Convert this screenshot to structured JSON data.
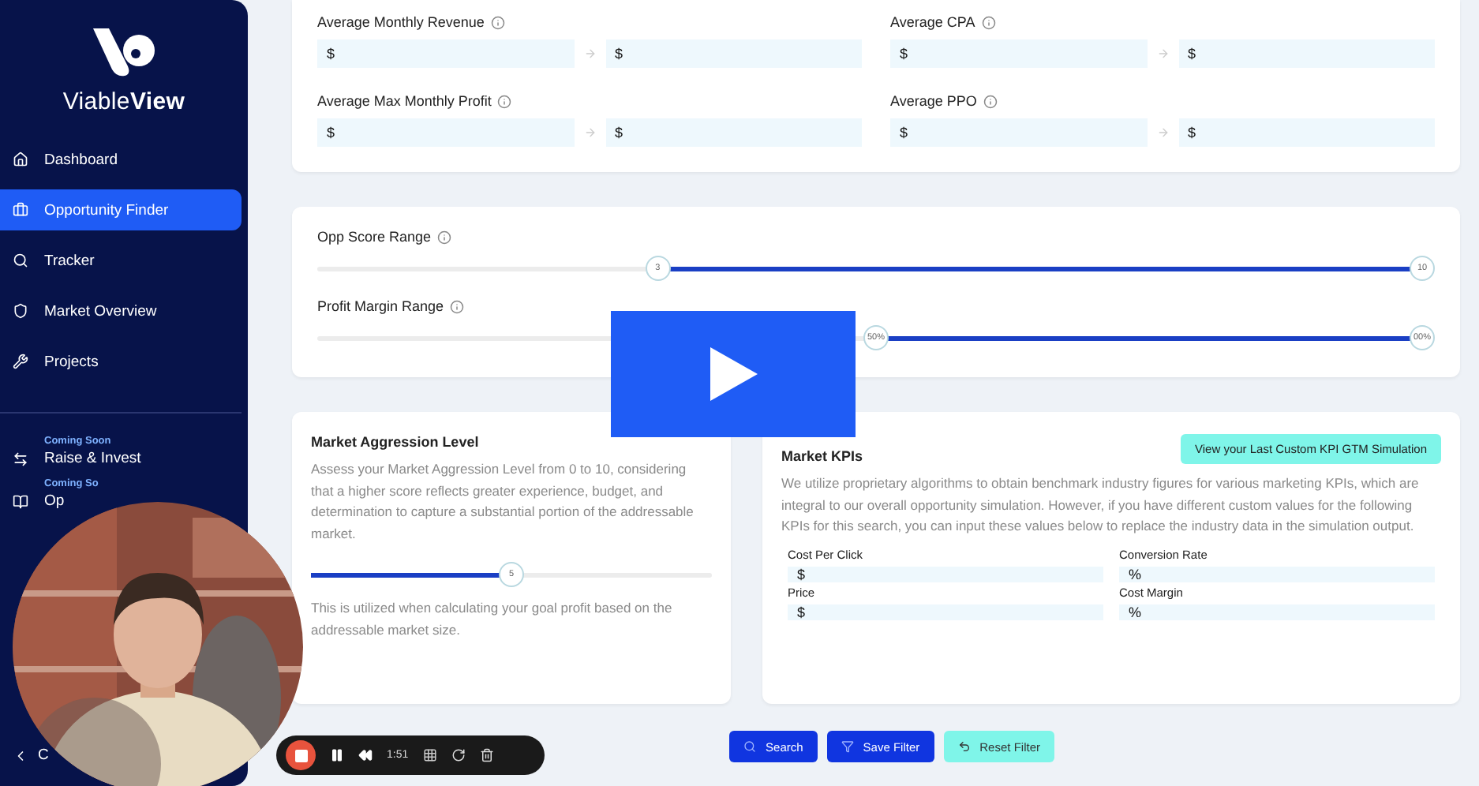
{
  "sidebar": {
    "logo_light": "Viable",
    "logo_bold": "View",
    "items": [
      {
        "label": "Dashboard",
        "selected": false
      },
      {
        "label": "Opportunity Finder",
        "selected": true
      },
      {
        "label": "Tracker",
        "selected": false
      },
      {
        "label": "Market Overview",
        "selected": false
      },
      {
        "label": "Projects",
        "selected": false
      }
    ],
    "soon_items": [
      {
        "badge": "Coming Soon",
        "label": "Raise & Invest"
      },
      {
        "badge": "Coming So",
        "label": "Op"
      }
    ],
    "collapse": {
      "label": "C"
    }
  },
  "filters": [
    {
      "label": "Average Monthly Revenue",
      "prefix": "$"
    },
    {
      "label": "Average CPA",
      "prefix": "$"
    },
    {
      "label": "Average Max Monthly Profit",
      "prefix": "$"
    },
    {
      "label": "Average PPO",
      "prefix": "$"
    }
  ],
  "range_sliders": [
    {
      "label": "Opp Score Range",
      "thumbs": [
        {
          "label": "3",
          "level": 0.3
        },
        {
          "label": "10",
          "level": 1
        }
      ]
    },
    {
      "label": "Profit Margin Range",
      "thumbs": [
        {
          "label": "50%",
          "level": 0.5
        },
        {
          "label": "00%",
          "level": 1
        }
      ]
    }
  ],
  "aggression": {
    "title": "Market Aggression Level",
    "description": "Assess your Market Aggression Level from 0 to 10, considering that a higher score reflects greater experience, budget, and determination to capture a substantial portion of the addressable market.",
    "slider": {
      "label": "5",
      "level": 0.5
    },
    "note": "This is utilized when calculating your goal profit based on the addressable market size."
  },
  "kpis": {
    "title": "Market KPIs",
    "button": "View your Last Custom KPI GTM Simulation",
    "description": "We utilize proprietary algorithms to obtain benchmark industry figures for various marketing KPIs, which are integral to our overall opportunity simulation. However, if you have different custom values for the following KPIs for this search, you can input these values below to replace the industry data in the simulation output.",
    "fields": [
      {
        "label": "Cost Per Click",
        "prefix": "$"
      },
      {
        "label": "Conversion Rate",
        "prefix": "%"
      },
      {
        "label": "Price",
        "prefix": "$"
      },
      {
        "label": "Cost Margin",
        "prefix": "%"
      }
    ]
  },
  "actions": [
    {
      "label": "Search",
      "kind": "primary"
    },
    {
      "label": "Save Filter",
      "kind": "primary"
    },
    {
      "label": "Reset Filter",
      "kind": "secondary"
    }
  ],
  "recorder": {
    "time": "1:51"
  }
}
